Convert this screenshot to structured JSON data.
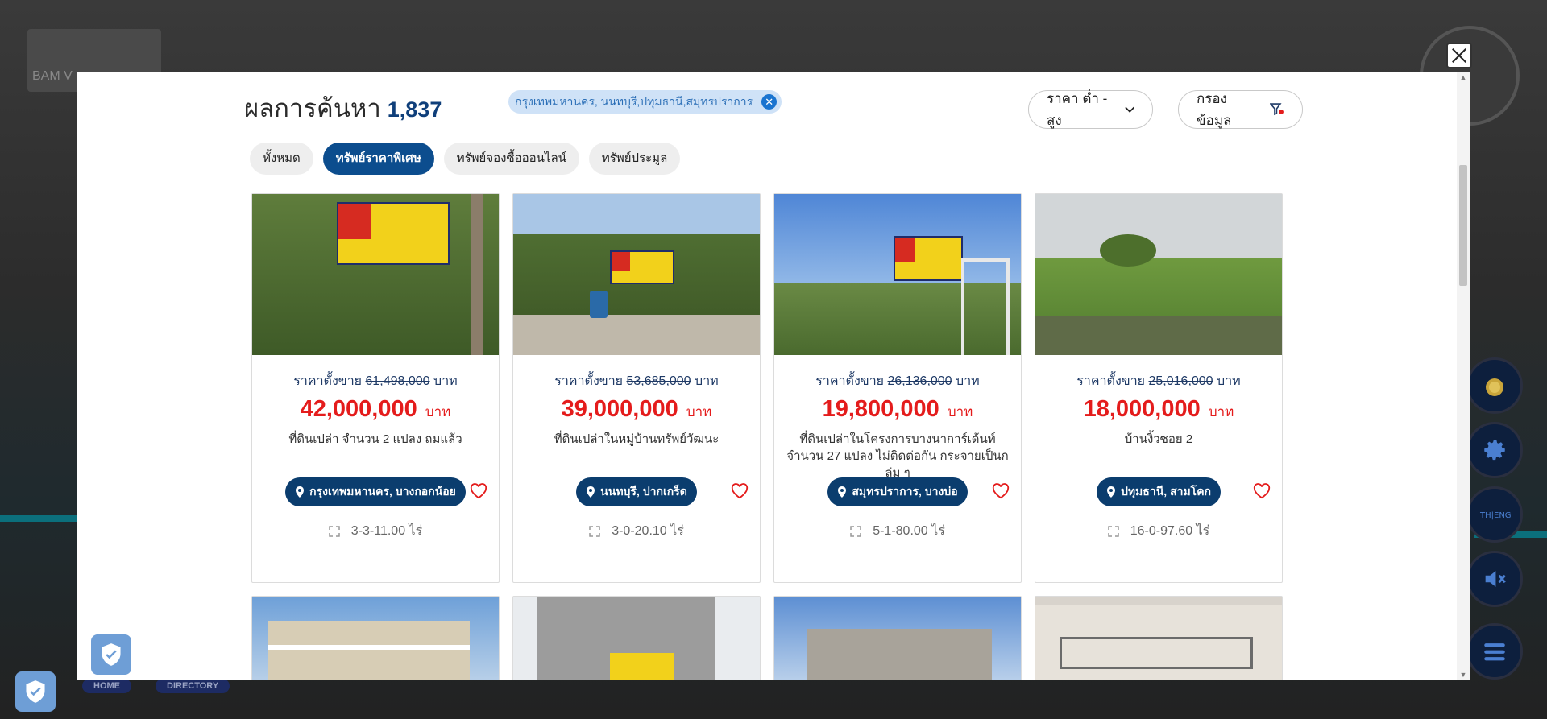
{
  "background": {
    "logo_text": "BAM V",
    "nav": [
      "HOME",
      "DIRECTORY"
    ]
  },
  "modal": {
    "title": "ผลการค้นหา",
    "result_count": "1,837",
    "filter_chip": "กรุงเทพมหานคร, นนทบุรี,ปทุมธานี,สมุทรปราการ",
    "sort_label": "ราคา ต่ำ - สูง",
    "filter_label": "กรองข้อมูล",
    "tabs": [
      {
        "label": "ทั้งหมด",
        "active": false
      },
      {
        "label": "ทรัพย์ราคาพิเศษ",
        "active": true
      },
      {
        "label": "ทรัพย์จองซื้อออนไลน์",
        "active": false
      },
      {
        "label": "ทรัพย์ประมูล",
        "active": false
      }
    ],
    "listings": [
      {
        "orig_prefix": "ราคาตั้งขาย",
        "orig_price": "61,498,000",
        "orig_suffix": "บาท",
        "price": "42,000,000",
        "price_unit": "บาท",
        "description": "ที่ดินเปล่า จำนวน 2 แปลง ถมแล้ว",
        "location": "กรุงเทพมหานคร, บางกอกน้อย",
        "area": "3-3-11.00 ไร่"
      },
      {
        "orig_prefix": "ราคาตั้งขาย",
        "orig_price": "53,685,000",
        "orig_suffix": "บาท",
        "price": "39,000,000",
        "price_unit": "บาท",
        "description": "ที่ดินเปล่าในหมู่บ้านทรัพย์วัฒนะ",
        "location": "นนทบุรี, ปากเกร็ด",
        "area": "3-0-20.10 ไร่"
      },
      {
        "orig_prefix": "ราคาตั้งขาย",
        "orig_price": "26,136,000",
        "orig_suffix": "บาท",
        "price": "19,800,000",
        "price_unit": "บาท",
        "description": "ที่ดินเปล่าในโครงการบางนาการ์เด้นท์ จำนวน 27 แปลง ไม่ติดต่อกัน กระจายเป็นกลุ่ม ๆ",
        "location": "สมุทรปราการ, บางบ่อ",
        "area": "5-1-80.00 ไร่"
      },
      {
        "orig_prefix": "ราคาตั้งขาย",
        "orig_price": "25,016,000",
        "orig_suffix": "บาท",
        "price": "18,000,000",
        "price_unit": "บาท",
        "description": "บ้านงิ้วซอย 2",
        "location": "ปทุมธานี, สามโคก",
        "area": "16-0-97.60 ไร่"
      }
    ]
  },
  "colors": {
    "accent_blue": "#0c4d8e",
    "price_red": "#e41c1c",
    "chip_bg": "#cfe2f7"
  }
}
